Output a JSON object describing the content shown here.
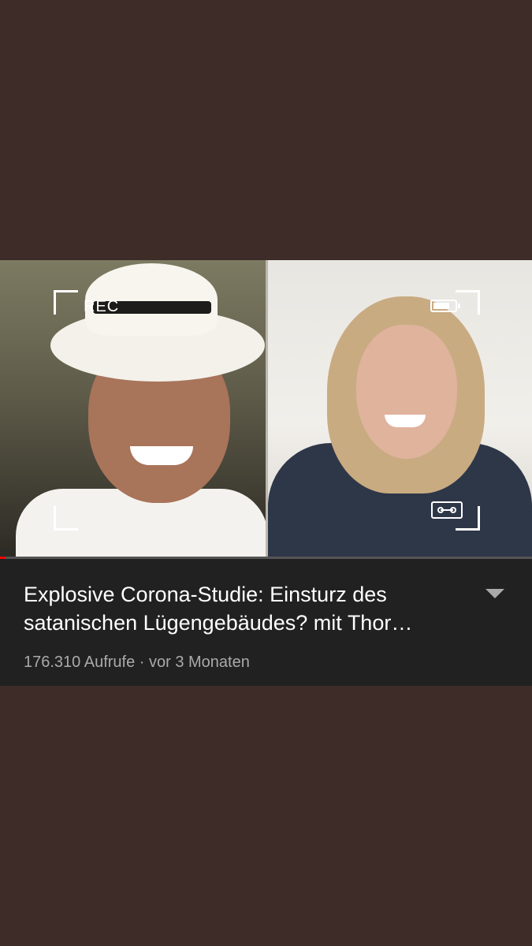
{
  "video": {
    "overlay": {
      "rec_label": "REC",
      "battery_level": 0.75
    },
    "progress_played_fraction": 0.01,
    "colors": {
      "progress_played": "#ff0000",
      "background": "#3e2c29",
      "info_panel": "#212121"
    }
  },
  "details": {
    "title_line1": "Explosive Corona-Studie: Einsturz des",
    "title_line2": "satanischen Lügengebäudes? mit Thor…",
    "meta": "176.310 Aufrufe · vor 3 Monaten",
    "expand_icon": "chevron-down-icon"
  }
}
